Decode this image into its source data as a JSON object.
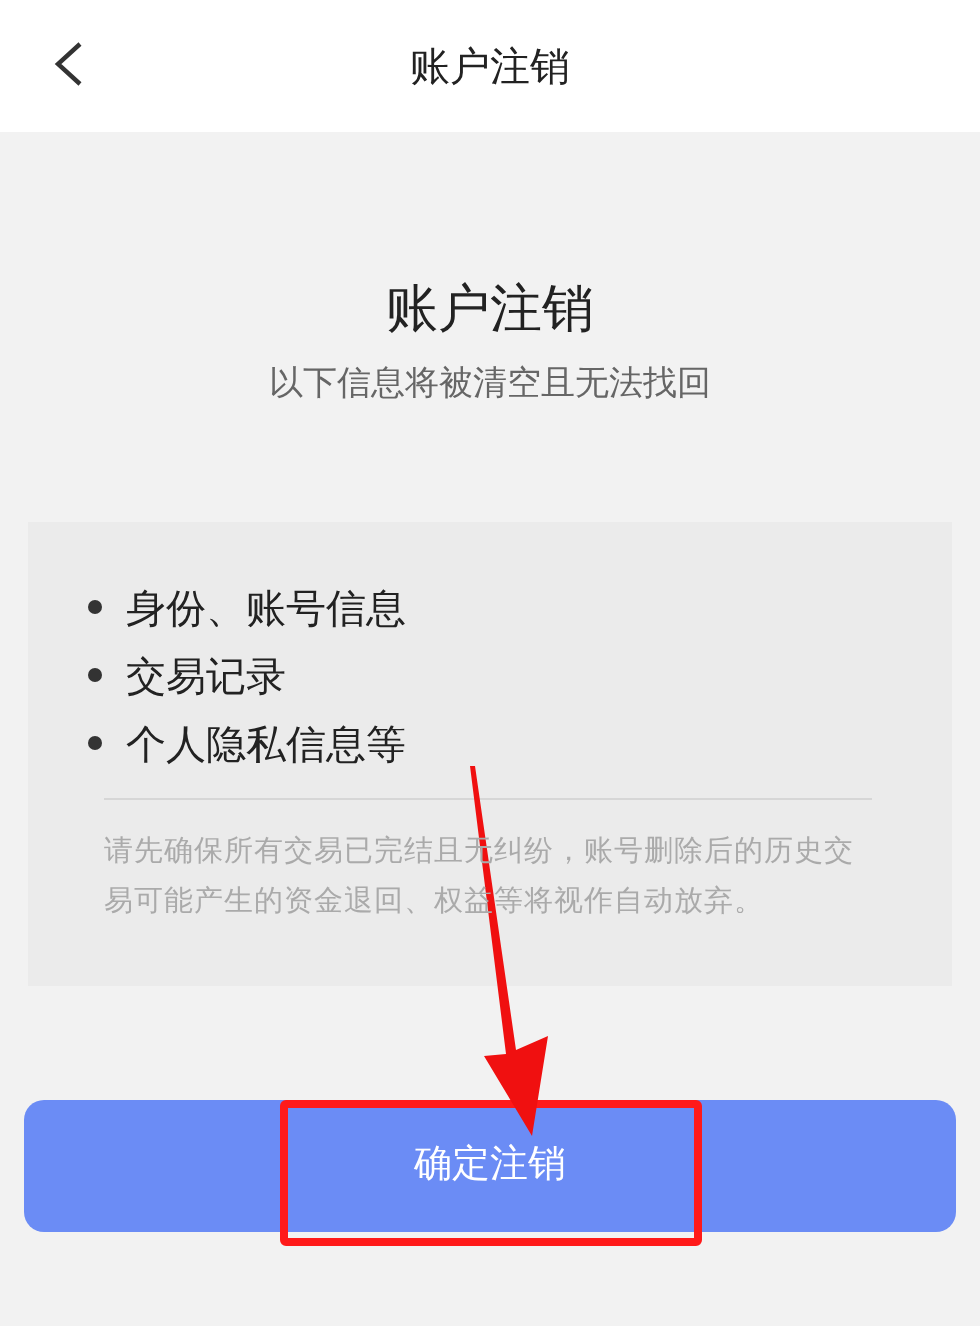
{
  "header": {
    "title": "账户注销"
  },
  "intro": {
    "title": "账户注销",
    "subtitle": "以下信息将被清空且无法找回"
  },
  "items": [
    "身份、账号信息",
    "交易记录",
    "个人隐私信息等"
  ],
  "note": "请先确保所有交易已完结且无纠纷，账号删除后的历史交易可能产生的资金退回、权益等将视作自动放弃。",
  "button": {
    "label": "确定注销"
  }
}
